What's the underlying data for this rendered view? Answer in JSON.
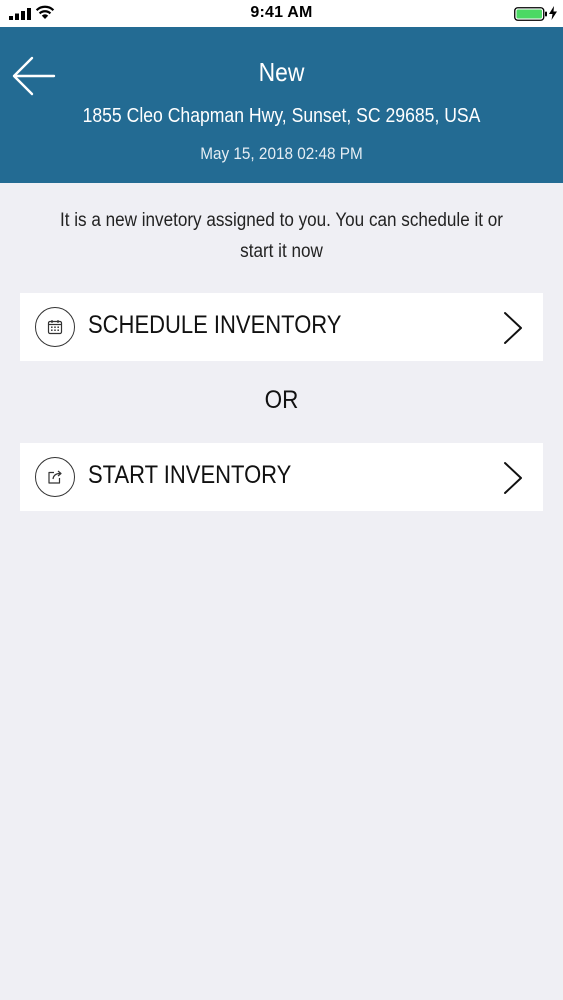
{
  "status_bar": {
    "time": "9:41 AM"
  },
  "header": {
    "title": "New",
    "address": "1855 Cleo Chapman Hwy, Sunset, SC 29685, USA",
    "datetime": "May 15, 2018 02:48 PM",
    "background_color": "#236b93"
  },
  "message": "It is a new invetory assigned to you. You can schedule it or start it now",
  "options": {
    "schedule_label": "SCHEDULE INVENTORY",
    "or_label": "OR",
    "start_label": "START INVENTORY"
  },
  "icons": {
    "back": "arrow-left-icon",
    "schedule": "calendar-icon",
    "start": "share-icon",
    "chevron": "chevron-right-icon"
  },
  "colors": {
    "battery": "#4cd964",
    "background": "#efeff4"
  }
}
